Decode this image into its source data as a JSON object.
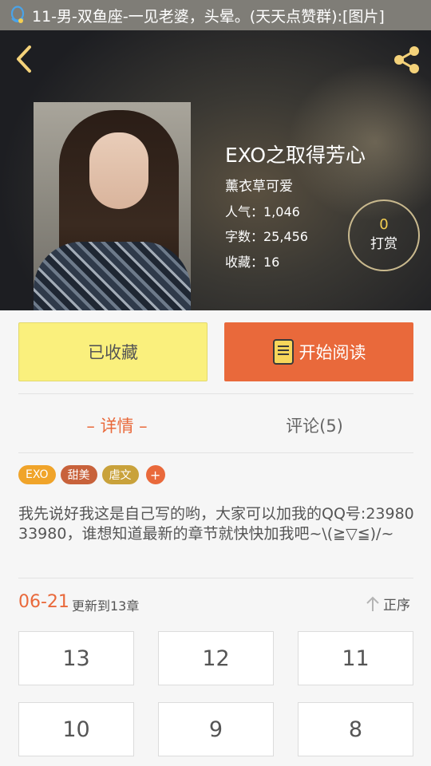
{
  "status_bar": {
    "notification": "11-男-双鱼座-一见老婆，头晕。(天天点赞群):[图片]"
  },
  "book": {
    "title": "EXO之取得芳心",
    "author": "薰衣草可爱",
    "popularity": "人气：1,046",
    "word_count": "字数：25,456",
    "favorites": "收藏：16"
  },
  "tip": {
    "count": "0",
    "label": "打赏"
  },
  "actions": {
    "favorited_label": "已收藏",
    "start_reading_label": "开始阅读"
  },
  "tabs": [
    {
      "label": "– 详情 –",
      "active": true
    },
    {
      "label": "评论(5)",
      "active": false
    }
  ],
  "tags": [
    {
      "label": "EXO",
      "color": "#f0a42a"
    },
    {
      "label": "甜美",
      "color": "#c8623b"
    },
    {
      "label": "虐文",
      "color": "#c9a23b"
    }
  ],
  "tag_add_label": "+",
  "description": "我先说好我这是自己写的哟，大家可以加我的QQ号:2398033980，谁想知道最新的章节就快快加我吧~\\(≧▽≦)/~",
  "chapters": {
    "update_date": "06-21",
    "update_text": "更新到13章",
    "sort_label": "正序",
    "items": [
      "13",
      "12",
      "11",
      "10",
      "9",
      "8"
    ]
  },
  "colors": {
    "accent": "#e9693b",
    "favorite_button": "#faf07d",
    "tip_count": "#f4cf52"
  },
  "icons": [
    "qq-icon",
    "back-arrow-icon",
    "share-icon",
    "book-icon",
    "arrow-up-icon"
  ]
}
